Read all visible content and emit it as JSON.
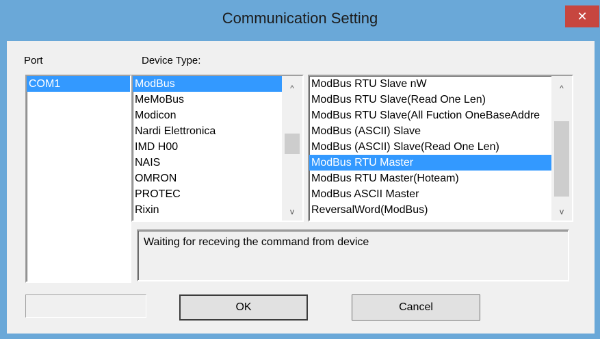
{
  "window": {
    "title": "Communication Setting",
    "close_glyph": "✕"
  },
  "port": {
    "label": "Port",
    "items": [
      {
        "label": "COM1",
        "selected": true
      }
    ]
  },
  "device_type": {
    "label": "Device Type:",
    "items": [
      {
        "label": "ModBus",
        "selected": true
      },
      {
        "label": "MeMoBus",
        "selected": false
      },
      {
        "label": "Modicon",
        "selected": false
      },
      {
        "label": "Nardi Elettronica",
        "selected": false
      },
      {
        "label": "IMD H00",
        "selected": false
      },
      {
        "label": "NAIS",
        "selected": false
      },
      {
        "label": "OMRON",
        "selected": false
      },
      {
        "label": "PROTEC",
        "selected": false
      },
      {
        "label": "Rixin",
        "selected": false
      }
    ]
  },
  "protocol": {
    "items": [
      {
        "label": "ModBus RTU Slave nW",
        "selected": false
      },
      {
        "label": "ModBus RTU Slave(Read One Len)",
        "selected": false
      },
      {
        "label": "ModBus RTU Slave(All Fuction OneBaseAddre",
        "selected": false
      },
      {
        "label": "ModBus (ASCII) Slave",
        "selected": false
      },
      {
        "label": "ModBus (ASCII) Slave(Read One Len)",
        "selected": false
      },
      {
        "label": "ModBus RTU Master",
        "selected": true
      },
      {
        "label": "ModBus RTU Master(Hoteam)",
        "selected": false
      },
      {
        "label": "ModBus ASCII Master",
        "selected": false
      },
      {
        "label": "ReversalWord(ModBus)",
        "selected": false
      }
    ]
  },
  "status": {
    "text": "Waiting for receving the command from device"
  },
  "buttons": {
    "ok": "OK",
    "cancel": "Cancel"
  },
  "icons": {
    "scroll_up": "^",
    "scroll_down": "v"
  },
  "colors": {
    "selection": "#3399ff",
    "titlebar": "#6aa8d8",
    "close": "#c7463f"
  }
}
